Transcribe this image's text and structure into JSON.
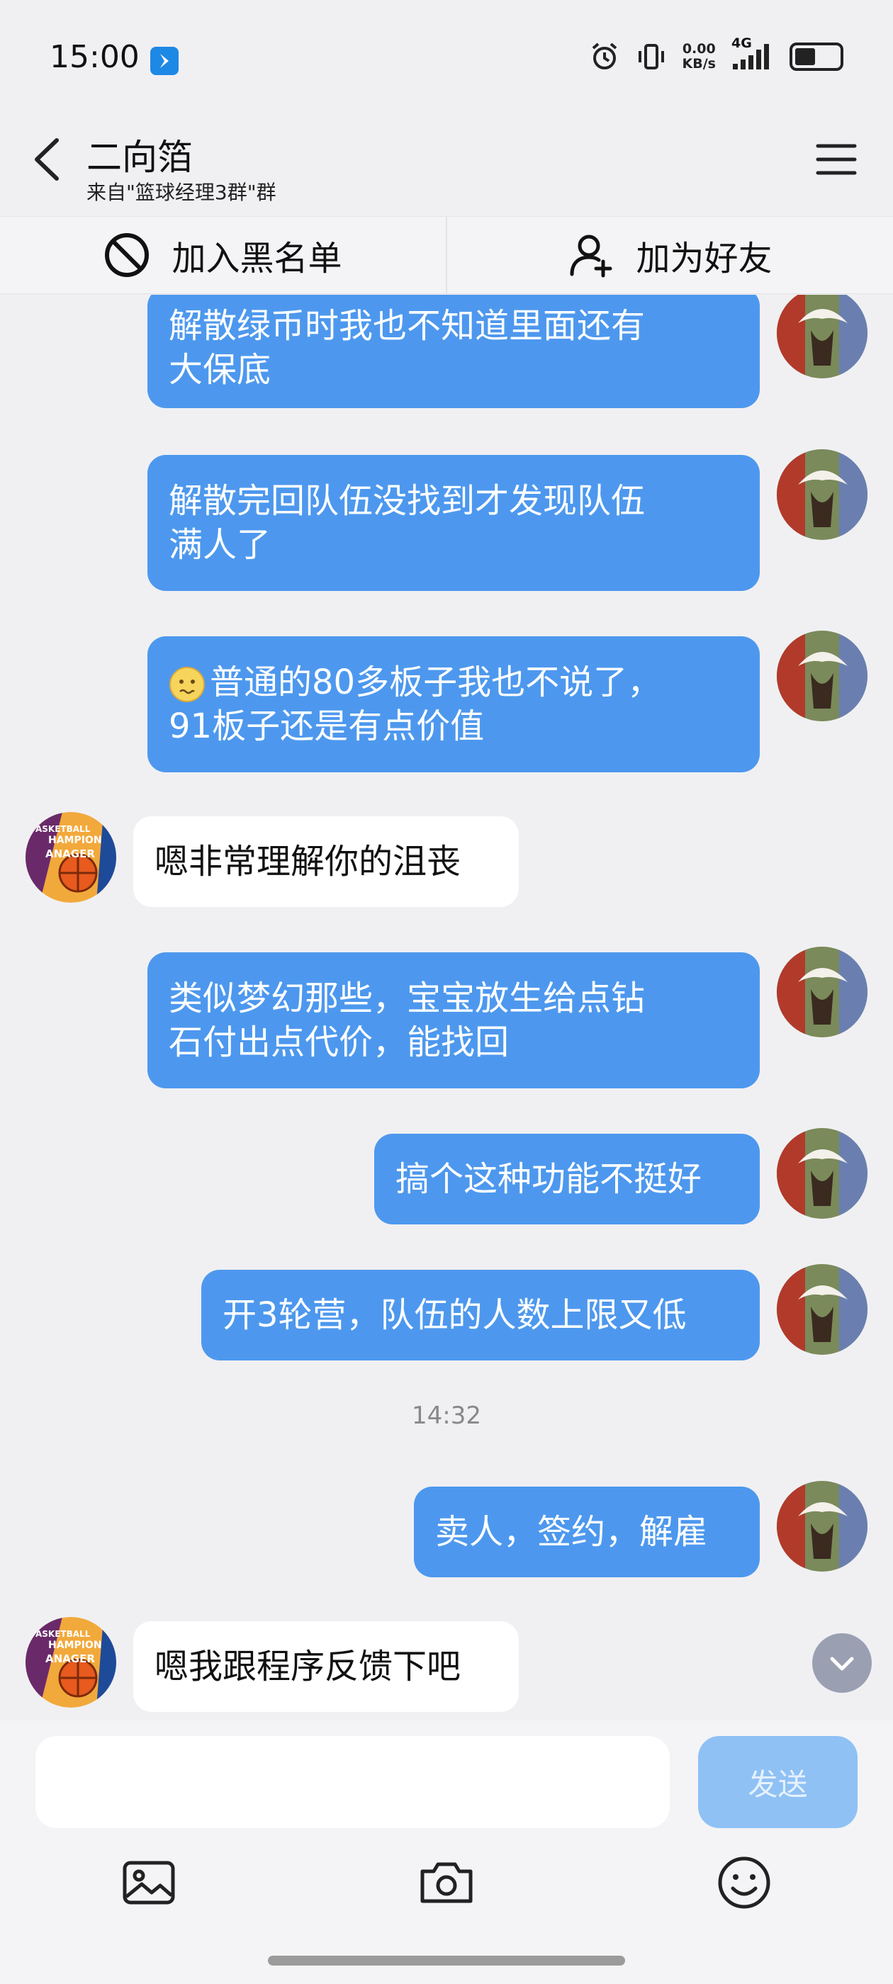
{
  "status": {
    "time": "15:00",
    "net_speed_value": "0.00",
    "net_speed_unit": "KB/s",
    "network_type": "4G"
  },
  "header": {
    "title": "二向箔",
    "subtitle": "来自\"篮球经理3群\"群"
  },
  "actions": {
    "blacklist_label": "加入黑名单",
    "add_friend_label": "加为好友"
  },
  "messages": [
    {
      "side": "me",
      "line1": "解散绿币时我也不知道里面还有",
      "line2": "大保底"
    },
    {
      "side": "me",
      "line1": "解散完回队伍没找到才发现队伍",
      "line2": "满人了"
    },
    {
      "side": "me",
      "line1": "普通的80多板子我也不说了，",
      "line2": "91板子还是有点价值"
    },
    {
      "side": "them",
      "text": "嗯非常理解你的沮丧"
    },
    {
      "side": "me",
      "line1": "类似梦幻那些，宝宝放生给点钻",
      "line2": "石付出点代价，能找回"
    },
    {
      "side": "me",
      "text": "搞个这种功能不挺好"
    },
    {
      "side": "me",
      "text": "开3轮营，队伍的人数上限又低"
    },
    {
      "side": "me",
      "text": "卖人，签约，解雇"
    },
    {
      "side": "them",
      "text": "嗯我跟程序反馈下吧"
    }
  ],
  "timestamp": "14:32",
  "avatar_text": {
    "line1": "ASKETBALL",
    "line2": "HAMPION",
    "line3": "ANAGER"
  },
  "input": {
    "placeholder": "",
    "send_label": "发送"
  },
  "colors": {
    "my_bubble": "#4d98ee",
    "their_bubble": "#ffffff",
    "send_disabled": "#8fc1f5",
    "background": "#f0f0f3"
  },
  "icons": {
    "back": "chevron-left-icon",
    "menu": "hamburger-menu-icon",
    "blacklist": "prohibit-icon",
    "add_friend": "add-user-icon",
    "image": "image-icon",
    "camera": "camera-icon",
    "emoji": "emoji-icon",
    "scroll_down": "chevron-down-icon"
  }
}
